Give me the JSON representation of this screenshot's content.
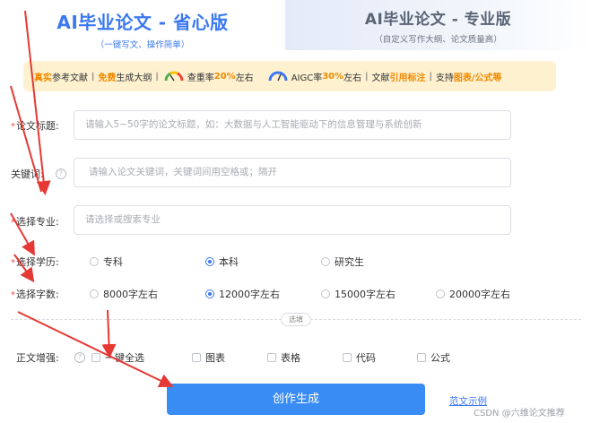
{
  "tabs": {
    "active": {
      "title": "AI毕业论文 - 省心版",
      "subtitle": "（一键写文、操作简单）"
    },
    "inactive": {
      "title": "AI毕业论文 - 专业版",
      "subtitle": "（自定义写作大纲、论文质量高）"
    }
  },
  "banner": {
    "part1_hl": "真实",
    "part1": "参考文献",
    "sep": "|",
    "part2_hl": "免费",
    "part2": "生成大纲",
    "part3_a": "查重率",
    "part3_hl": "20%",
    "part3_b": "左右",
    "part4_a": "AIGC率",
    "part4_hl": "30%",
    "part4_b": "左右",
    "part5_a": "文献",
    "part5_hl": "引用标注",
    "part6_a": "支持",
    "part6_hl": "图表/公式等",
    "gauge1_icon": "gauge-icon",
    "gauge2_icon": "gauge-icon"
  },
  "form": {
    "title": {
      "label": "论文标题:",
      "placeholder": "请输入5~50字的论文标题，如：大数据与人工智能驱动下的信息管理与系统创新"
    },
    "keywords": {
      "label": "关键词:",
      "help": "?",
      "placeholder": "请输入论文关键词，关键词间用空格或；隔开"
    },
    "major": {
      "label": "选择专业:",
      "placeholder": "请选择或搜索专业"
    },
    "degree": {
      "label": "选择学历:",
      "options": [
        "专科",
        "本科",
        "研究生"
      ],
      "selected": "本科"
    },
    "wordcount": {
      "label": "选择字数:",
      "options": [
        "8000字左右",
        "12000字左右",
        "15000字左右",
        "20000字左右"
      ],
      "selected": "12000字左右"
    },
    "optional_badge": "选填",
    "enhance": {
      "label": "正文增强:",
      "options": [
        "一键全选",
        "图表",
        "表格",
        "代码",
        "公式"
      ]
    }
  },
  "submit_label": "创作生成",
  "example_link": "范文示例",
  "watermark": "CSDN @六维论文推荐",
  "colors": {
    "accent": "#3a78f2",
    "button": "#3a8cf5",
    "highlight": "#f08a00",
    "arrow": "#e53935"
  }
}
